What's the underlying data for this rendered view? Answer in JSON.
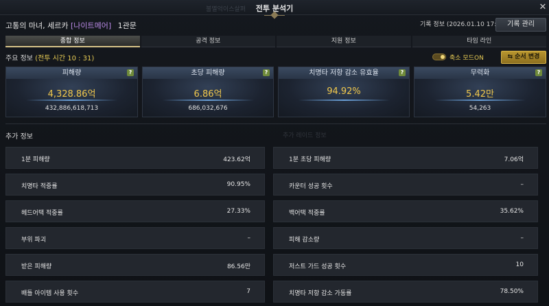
{
  "window": {
    "title": "전투 분석기",
    "ghost_text": "불멸억이스살펴",
    "close_glyph": "✕"
  },
  "header": {
    "name": "고통의 마녀, 세르카",
    "role": "[나이트메어]",
    "gate": "1관문",
    "record_info": "기록 정보 (2026.01.10 17:10:34)",
    "record_button": "기록 관리"
  },
  "tabs": [
    {
      "label": "종합 정보",
      "active": true
    },
    {
      "label": "공격 정보",
      "active": false
    },
    {
      "label": "지원 정보",
      "active": false
    },
    {
      "label": "타임 라인",
      "active": false
    }
  ],
  "main": {
    "label": "주요 정보",
    "battle_time": "(전투 시간 10 : 31)",
    "toggle_label": "축소 모드ON",
    "toggle_on": true,
    "order_button": "순서 변경",
    "order_icon": "⇆"
  },
  "cards": [
    {
      "title": "피해량",
      "big": "4,328.86억",
      "small": "432,886,618,713"
    },
    {
      "title": "초당 피해량",
      "big": "6.86억",
      "small": "686,032,676"
    },
    {
      "title": "치명타 저항 감소 유효율",
      "big": "94.92%",
      "small": ""
    },
    {
      "title": "무력화",
      "big": "5.42만",
      "small": "54,263"
    }
  ],
  "help_glyph": "?",
  "extra": {
    "label": "추가 정보",
    "ghost": "추가 레이드 정보",
    "left": [
      {
        "label": "1분 피해량",
        "value": "423.62억"
      },
      {
        "label": "치명타 적중률",
        "value": "90.95%"
      },
      {
        "label": "헤드어택 적중률",
        "value": "27.33%"
      },
      {
        "label": "부위 파괴",
        "value": "–"
      },
      {
        "label": "받은 피해량",
        "value": "86.56만"
      },
      {
        "label": "배틀 아이템 사용 횟수",
        "value": "7"
      }
    ],
    "right": [
      {
        "label": "1분 초당 피해량",
        "value": "7.06억"
      },
      {
        "label": "카운터 성공 횟수",
        "value": "–"
      },
      {
        "label": "백어택 적중률",
        "value": "35.62%"
      },
      {
        "label": "피해 감소량",
        "value": "–"
      },
      {
        "label": "저스트 가드 성공 횟수",
        "value": "10"
      },
      {
        "label": "치명타 저항 감소 가동률",
        "value": "78.50%"
      }
    ]
  }
}
